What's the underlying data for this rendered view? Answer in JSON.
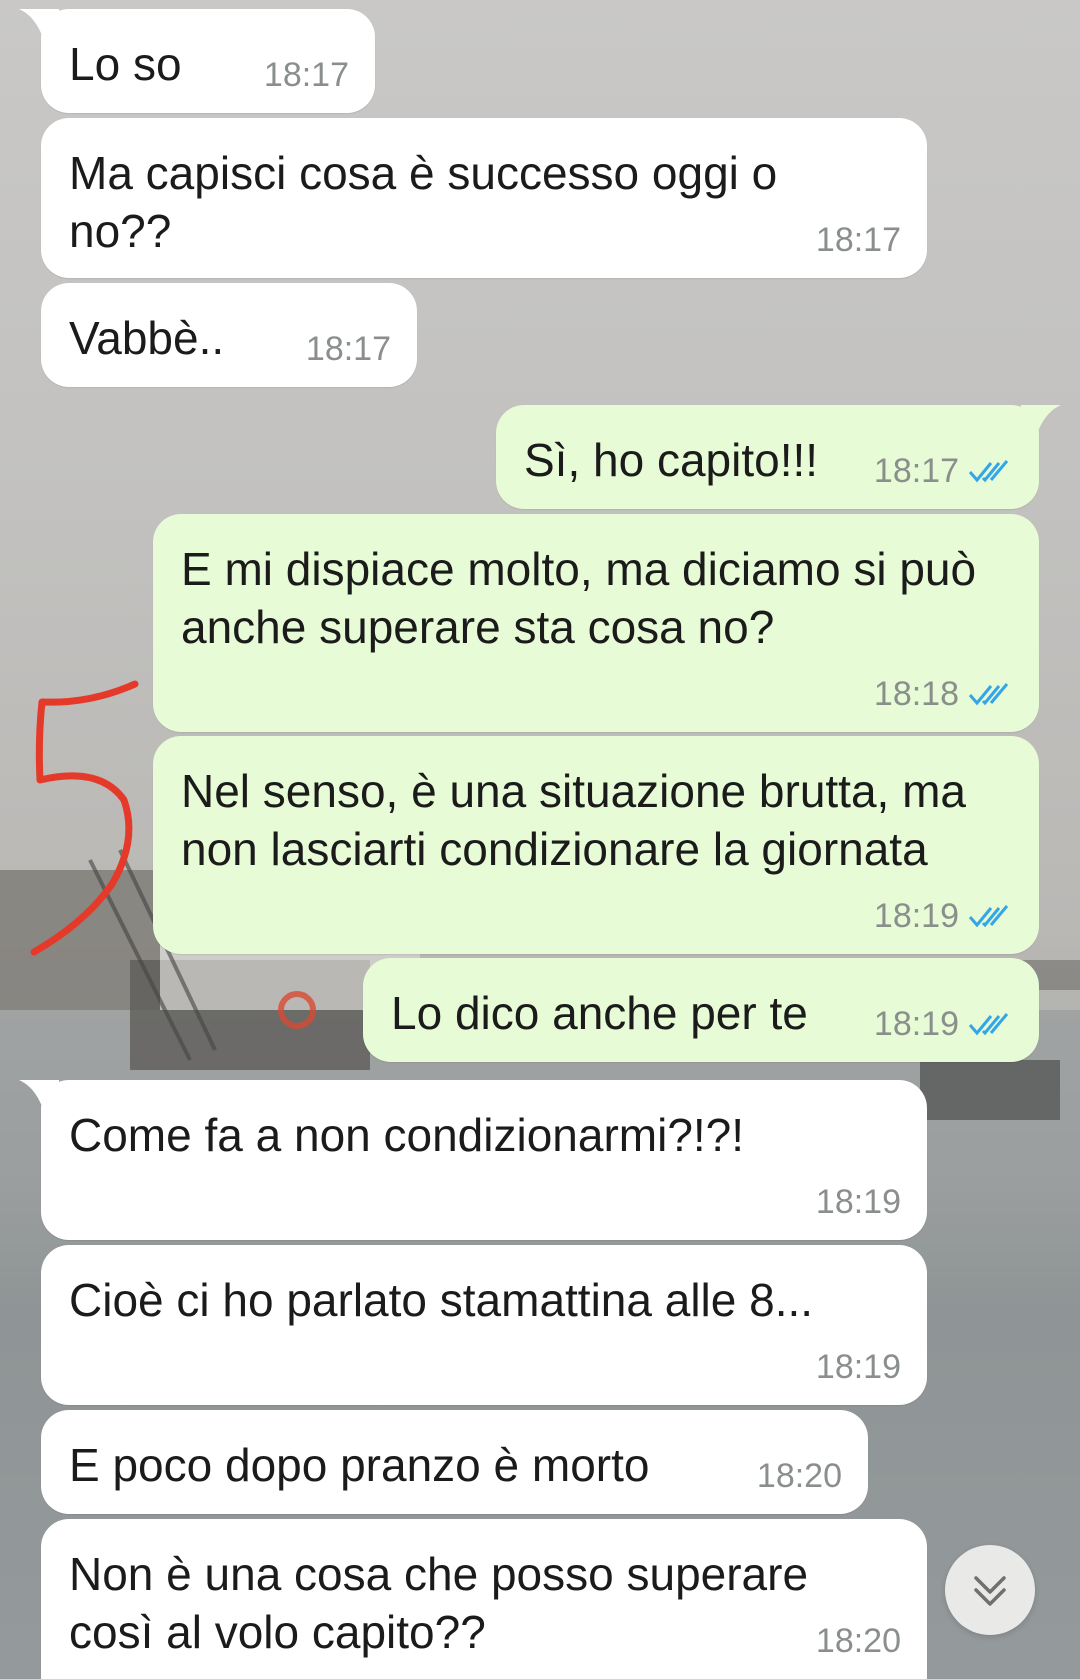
{
  "colors": {
    "incoming_bubble": "#ffffff",
    "outgoing_bubble": "#e6fbd6",
    "read_ticks": "#34a6e8",
    "annotation": "#e53a2a"
  },
  "messages": [
    {
      "direction": "in",
      "text": "Lo so",
      "time": "18:17"
    },
    {
      "direction": "in",
      "text": "Ma capisci cosa è successo oggi o no??",
      "time": "18:17"
    },
    {
      "direction": "in",
      "text": "Vabbè..",
      "time": "18:17"
    },
    {
      "direction": "out",
      "text": "Sì, ho capito!!!",
      "time": "18:17",
      "status": "read"
    },
    {
      "direction": "out",
      "text": "E mi dispiace molto, ma diciamo si può anche superare sta cosa no?",
      "time": "18:18",
      "status": "read"
    },
    {
      "direction": "out",
      "text": "Nel senso, è una situazione brutta, ma non lasciarti condizionare la giornata",
      "time": "18:19",
      "status": "read"
    },
    {
      "direction": "out",
      "text": "Lo dico anche per te",
      "time": "18:19",
      "status": "read"
    },
    {
      "direction": "in",
      "text": "Come fa a non condizionarmi?!?!",
      "time": "18:19"
    },
    {
      "direction": "in",
      "text": "Cioè ci ho parlato stamattina alle 8...",
      "time": "18:19"
    },
    {
      "direction": "in",
      "text": "E poco dopo pranzo è morto",
      "time": "18:20"
    },
    {
      "direction": "in",
      "text": "Non è una cosa che posso superare così al volo capito??",
      "time": "18:20"
    }
  ],
  "annotation": {
    "glyph": "5"
  },
  "scroll_down_icon": "double-chevron-down-icon"
}
